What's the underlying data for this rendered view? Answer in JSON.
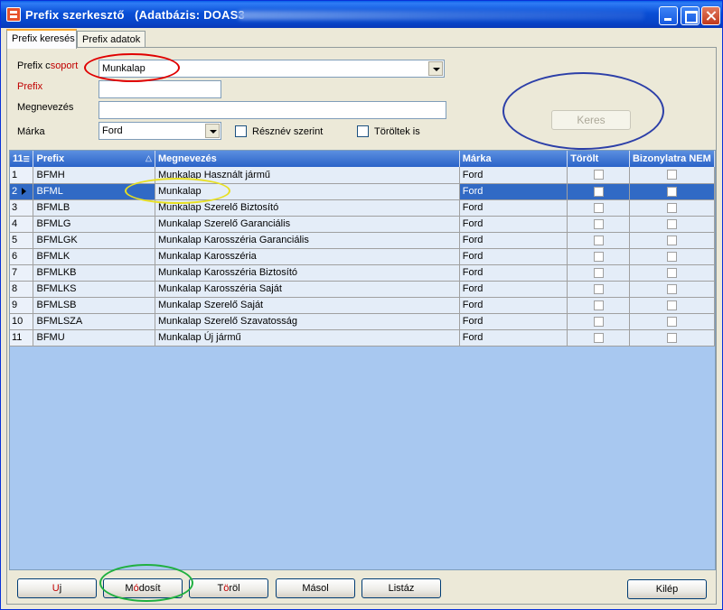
{
  "window": {
    "title": "Prefix szerkesztő",
    "db_label": "(Adatbázis: DOAS3"
  },
  "tabs": [
    {
      "label": "Prefix keresés",
      "active": true
    },
    {
      "label": "Prefix adatok",
      "active": false
    }
  ],
  "filters": {
    "group_label_1": "Prefix c",
    "group_label_2": "soport",
    "group_value": "Munkalap",
    "prefix_label": "Prefix",
    "prefix_value": "",
    "name_label": "Megnevezés",
    "name_value": "",
    "brand_label": "Márka",
    "brand_value": "Ford",
    "partial_label": "Résznév szerint",
    "partial_checked": false,
    "deleted_label": "Töröltek is",
    "deleted_checked": false,
    "search_button": "Keres"
  },
  "grid": {
    "count_header": "11",
    "columns": [
      "Prefix",
      "Megnevezés",
      "Márka",
      "Törölt",
      "Bizonylatra NEM"
    ],
    "rows": [
      {
        "n": "1",
        "prefix": "BFMH",
        "name": "Munkalap Használt jármű",
        "brand": "Ford",
        "deleted": false,
        "no_doc": false
      },
      {
        "n": "2",
        "prefix": "BFML",
        "name": "Munkalap",
        "brand": "Ford",
        "deleted": false,
        "no_doc": false,
        "selected": true
      },
      {
        "n": "3",
        "prefix": "BFMLB",
        "name": "Munkalap Szerelő Biztosító",
        "brand": "Ford",
        "deleted": false,
        "no_doc": false
      },
      {
        "n": "4",
        "prefix": "BFMLG",
        "name": "Munkalap Szerelő Garanciális",
        "brand": "Ford",
        "deleted": false,
        "no_doc": false
      },
      {
        "n": "5",
        "prefix": "BFMLGK",
        "name": "Munkalap Karosszéria Garanciális",
        "brand": "Ford",
        "deleted": false,
        "no_doc": false
      },
      {
        "n": "6",
        "prefix": "BFMLK",
        "name": "Munkalap Karosszéria",
        "brand": "Ford",
        "deleted": false,
        "no_doc": false
      },
      {
        "n": "7",
        "prefix": "BFMLKB",
        "name": "Munkalap Karosszéria Biztosító",
        "brand": "Ford",
        "deleted": false,
        "no_doc": false
      },
      {
        "n": "8",
        "prefix": "BFMLKS",
        "name": "Munkalap Karosszéria Saját",
        "brand": "Ford",
        "deleted": false,
        "no_doc": false
      },
      {
        "n": "9",
        "prefix": "BFMLSB",
        "name": "Munkalap Szerelő Saját",
        "brand": "Ford",
        "deleted": false,
        "no_doc": false
      },
      {
        "n": "10",
        "prefix": "BFMLSZA",
        "name": "Munkalap Szerelő Szavatosság",
        "brand": "Ford",
        "deleted": false,
        "no_doc": false
      },
      {
        "n": "11",
        "prefix": "BFMU",
        "name": "Munkalap Új jármű",
        "brand": "Ford",
        "deleted": false,
        "no_doc": false
      }
    ]
  },
  "buttons": {
    "new_1": "U",
    "new_2": "j",
    "modify_1": "M",
    "modify_2": "ó",
    "modify_3": "dosít",
    "delete_1": "T",
    "delete_2": "ö",
    "delete_3": "röl",
    "copy": "Másol",
    "list": "Listáz",
    "exit": "Kilép"
  },
  "colors": {
    "titlebar": "#0a4fd6",
    "grid_header": "#2b63c8",
    "selection": "#316ac5",
    "grid_background": "#a8c8f0",
    "annotation_red": "#e00000",
    "annotation_blue": "#2c3fa8",
    "annotation_yellow": "#e8e020",
    "annotation_green": "#20b040"
  }
}
